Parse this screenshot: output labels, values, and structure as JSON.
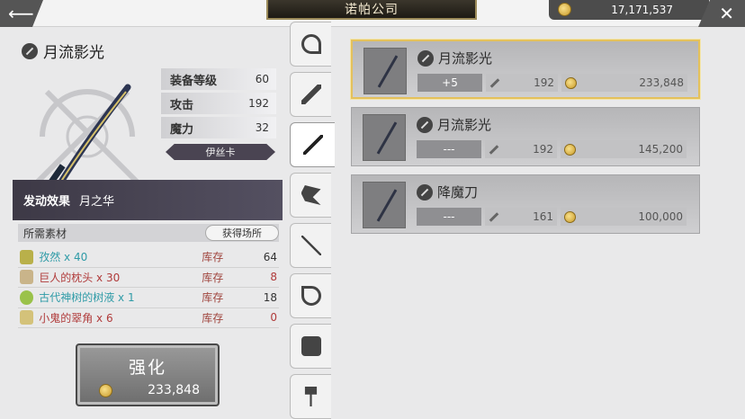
{
  "header": {
    "title": "诺帕公司",
    "gold": "17,171,537"
  },
  "weapon": {
    "name": "月流影光",
    "stats": [
      {
        "label": "装备等级",
        "value": "60"
      },
      {
        "label": "攻击",
        "value": "192"
      },
      {
        "label": "魔力",
        "value": "32"
      }
    ],
    "character": "伊丝卡",
    "effect_label": "发动效果",
    "effect_value": "月之华"
  },
  "materials": {
    "header": "所需素材",
    "source_button": "获得场所",
    "items": [
      {
        "name": "孜然 x 40",
        "stock_label": "库存",
        "count": "64"
      },
      {
        "name": "巨人的枕头 x 30",
        "stock_label": "库存",
        "count": "8"
      },
      {
        "name": "古代神树的树液 x 1",
        "stock_label": "库存",
        "count": "18"
      },
      {
        "name": "小鬼的翠角 x 6",
        "stock_label": "库存",
        "count": "0"
      }
    ]
  },
  "enhance": {
    "label": "强化",
    "price": "233,848"
  },
  "tabs": [
    "staff-icon",
    "sword-icon",
    "katana-icon",
    "axe-icon",
    "spear-icon",
    "bow-icon",
    "fist-icon",
    "hammer-icon"
  ],
  "list": [
    {
      "name": "月流影光",
      "level": "+5",
      "attack": "192",
      "price": "233,848",
      "selected": true
    },
    {
      "name": "月流影光",
      "level": "---",
      "attack": "192",
      "price": "145,200",
      "selected": false
    },
    {
      "name": "降魔刀",
      "level": "---",
      "attack": "161",
      "price": "100,000",
      "selected": false
    }
  ],
  "colors": {
    "accent_gold": "#e4c15c",
    "effect_bar": "#3d3946",
    "stock_red": "#a0453e"
  }
}
